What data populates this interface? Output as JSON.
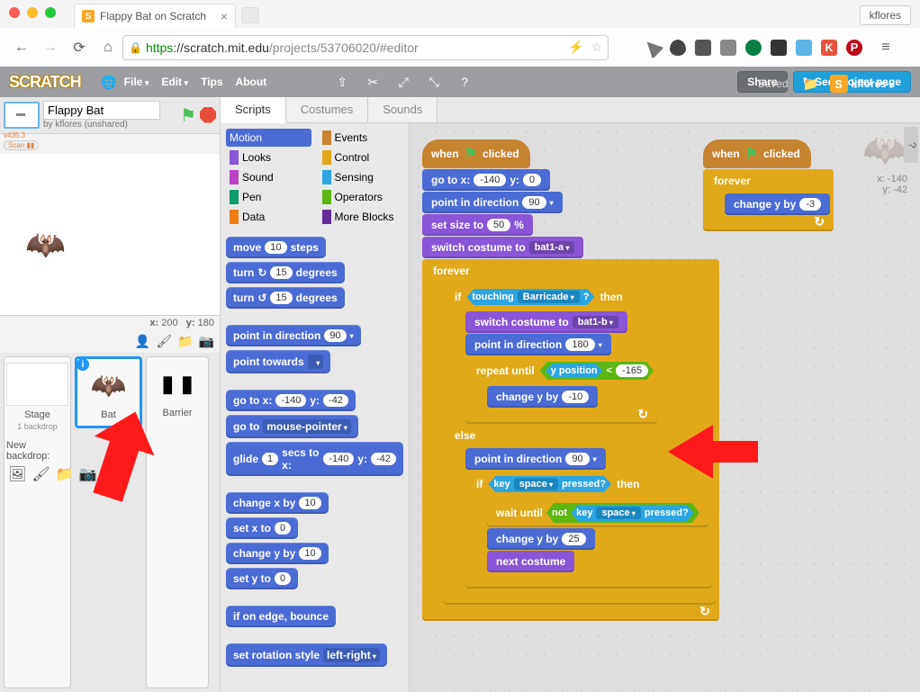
{
  "browser": {
    "tab_title": "Flappy Bat on Scratch",
    "user": "kflores",
    "url_https": "https",
    "url_host": "://scratch.mit.edu",
    "url_path": "/projects/53706020/#editor"
  },
  "scratch_menu": {
    "logo": "SCRATCH",
    "items": [
      "File",
      "Edit",
      "Tips",
      "About"
    ],
    "saved": "Saved",
    "share": "Share",
    "see_project": "See project page",
    "user": "kflores"
  },
  "project": {
    "title": "Flappy Bat",
    "byline": "by kflores (unshared)",
    "coords_x_label": "x:",
    "coords_x": "200",
    "coords_y_label": "y:",
    "coords_y": "180",
    "version": "v435.3"
  },
  "sprites": {
    "stage_label": "Stage",
    "stage_sub": "1 backdrop",
    "new_backdrop": "New backdrop:",
    "list": [
      {
        "name": "Bat",
        "selected": true
      },
      {
        "name": "Barrier",
        "selected": false
      }
    ]
  },
  "watermark": {
    "x_label": "x:",
    "x": "-140",
    "y_label": "y:",
    "y": "-42"
  },
  "tabs": [
    "Scripts",
    "Costumes",
    "Sounds"
  ],
  "categories": [
    {
      "name": "Motion",
      "color": "#4a6cd4",
      "sel": true
    },
    {
      "name": "Events",
      "color": "#c88330"
    },
    {
      "name": "Looks",
      "color": "#8a55d7"
    },
    {
      "name": "Control",
      "color": "#e1a91a"
    },
    {
      "name": "Sound",
      "color": "#bb42c3"
    },
    {
      "name": "Sensing",
      "color": "#2ca5e2"
    },
    {
      "name": "Pen",
      "color": "#0e9a6c"
    },
    {
      "name": "Operators",
      "color": "#5cb712"
    },
    {
      "name": "Data",
      "color": "#ee7d16"
    },
    {
      "name": "More Blocks",
      "color": "#632d99"
    }
  ],
  "palette": {
    "move": "move",
    "steps": "steps",
    "v10": "10",
    "turn": "turn",
    "degrees": "degrees",
    "v15": "15",
    "point_dir": "point in direction",
    "v90": "90",
    "point_towards": "point towards",
    "goto_xy": "go to x:",
    "y": "y:",
    "vn140": "-140",
    "vn42": "-42",
    "goto": "go to",
    "mouse": "mouse-pointer",
    "glide": "glide",
    "secs_to_x": "secs to x:",
    "v1": "1",
    "change_x": "change x by",
    "set_x": "set x to",
    "v0": "0",
    "change_y": "change y by",
    "set_y": "set y to",
    "if_edge": "if on edge, bounce",
    "set_rotation": "set rotation style",
    "lr": "left-right"
  },
  "script": {
    "when": "when",
    "clicked": "clicked",
    "goto_x": "go to x:",
    "y": "y:",
    "vn140": "-140",
    "v0": "0",
    "point_dir": "point in direction",
    "v90": "90",
    "v180": "180",
    "set_size": "set size to",
    "v50": "50",
    "pct": "%",
    "switch_costume": "switch costume to",
    "bat1a": "bat1-a",
    "bat1b": "bat1-b",
    "forever": "forever",
    "if": "if",
    "then": "then",
    "else": "else",
    "touching": "touching",
    "barricade": "Barricade",
    "q": "?",
    "repeat_until": "repeat until",
    "y_position": "y position",
    "lt": "<",
    "vn165": "-165",
    "change_y_by": "change y by",
    "vn10": "-10",
    "v25": "25",
    "vn3": "-3",
    "key": "key",
    "space": "space",
    "pressed": "pressed?",
    "wait_until": "wait until",
    "not": "not",
    "next_costume": "next costume"
  }
}
